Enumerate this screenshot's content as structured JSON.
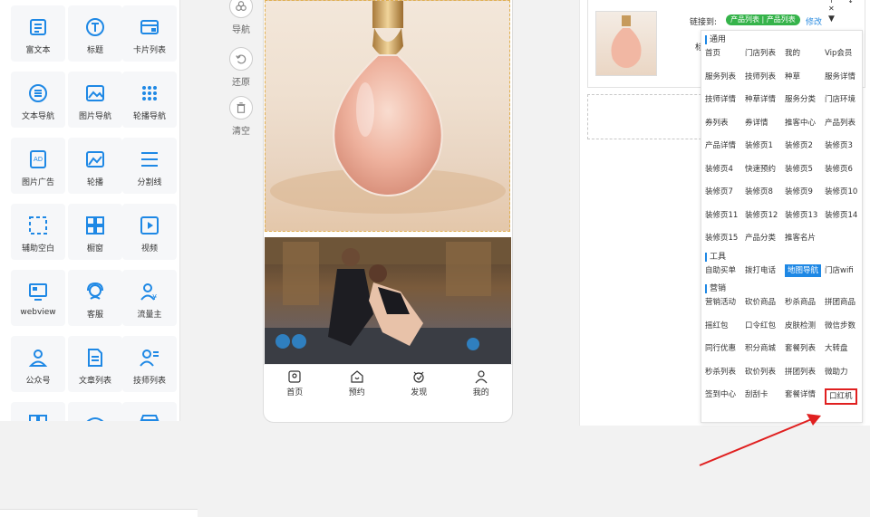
{
  "widgets": [
    {
      "label": "富文本",
      "icon": "rich-text-icon"
    },
    {
      "label": "标题",
      "icon": "title-icon"
    },
    {
      "label": "卡片列表",
      "icon": "card-list-icon"
    },
    {
      "label": "文本导航",
      "icon": "text-nav-icon"
    },
    {
      "label": "图片导航",
      "icon": "image-nav-icon"
    },
    {
      "label": "轮播导航",
      "icon": "carousel-nav-icon"
    },
    {
      "label": "图片广告",
      "icon": "image-ad-icon"
    },
    {
      "label": "轮播",
      "icon": "carousel-icon"
    },
    {
      "label": "分割线",
      "icon": "divider-icon"
    },
    {
      "label": "辅助空白",
      "icon": "blank-space-icon"
    },
    {
      "label": "橱窗",
      "icon": "showcase-icon"
    },
    {
      "label": "视频",
      "icon": "video-icon"
    },
    {
      "label": "webview",
      "icon": "webview-icon"
    },
    {
      "label": "客服",
      "icon": "customer-service-icon"
    },
    {
      "label": "流量主",
      "icon": "traffic-master-icon"
    },
    {
      "label": "公众号",
      "icon": "official-account-icon"
    },
    {
      "label": "文章列表",
      "icon": "article-list-icon"
    },
    {
      "label": "技师列表",
      "icon": "technician-list-icon"
    },
    {
      "label": "",
      "icon": "grid-widget-icon"
    },
    {
      "label": "",
      "icon": "store-widget-icon"
    },
    {
      "label": "",
      "icon": "shop-widget-icon"
    }
  ],
  "tools": [
    {
      "label": "导航",
      "icon": "nav-tool-icon"
    },
    {
      "label": "还原",
      "icon": "undo-icon"
    },
    {
      "label": "清空",
      "icon": "trash-icon"
    }
  ],
  "phone": {
    "tabs": [
      {
        "label": "首页",
        "icon": "home-icon"
      },
      {
        "label": "预约",
        "icon": "appointment-icon"
      },
      {
        "label": "发现",
        "icon": "discover-icon"
      },
      {
        "label": "我的",
        "icon": "profile-icon"
      }
    ]
  },
  "settings": {
    "link_label": "链接到:",
    "link_value": "产品列表 | 产品列表",
    "modify": "修改",
    "title_label": "标题"
  },
  "dropdown": {
    "sections": [
      {
        "title": "通用",
        "items": [
          "首页",
          "门店列表",
          "我的",
          "Vip会员",
          "服务列表",
          "技师列表",
          "种草",
          "服务详情",
          "技师详情",
          "种草详情",
          "服务分类",
          "门店环境",
          "券列表",
          "券详情",
          "推客中心",
          "产品列表",
          "产品详情",
          "装修页1",
          "装修页2",
          "装修页3",
          "装修页4",
          "快速预约",
          "装修页5",
          "装修页6",
          "装修页7",
          "装修页8",
          "装修页9",
          "装修页10",
          "装修页11",
          "装修页12",
          "装修页13",
          "装修页14",
          "装修页15",
          "产品分类",
          "推客名片"
        ]
      },
      {
        "title": "工具",
        "items": [
          "自助买单",
          "拨打电话",
          "地图导航",
          "门店wifi"
        ]
      },
      {
        "title": "营销",
        "items": [
          "营销活动",
          "砍价商品",
          "秒杀商品",
          "拼团商品",
          "摇红包",
          "口令红包",
          "皮肤检测",
          "微信步数",
          "同行优惠",
          "积分商城",
          "套餐列表",
          "大转盘",
          "秒杀列表",
          "砍价列表",
          "拼团列表",
          "微助力",
          "签到中心",
          "刮刮卡",
          "套餐详情",
          "口红机"
        ]
      }
    ],
    "active_item": "地图导航",
    "highlight_item": "口红机"
  },
  "colors": {
    "accent": "#1e88e5",
    "tag_green": "#35b34a",
    "highlight_red": "#e02020"
  }
}
